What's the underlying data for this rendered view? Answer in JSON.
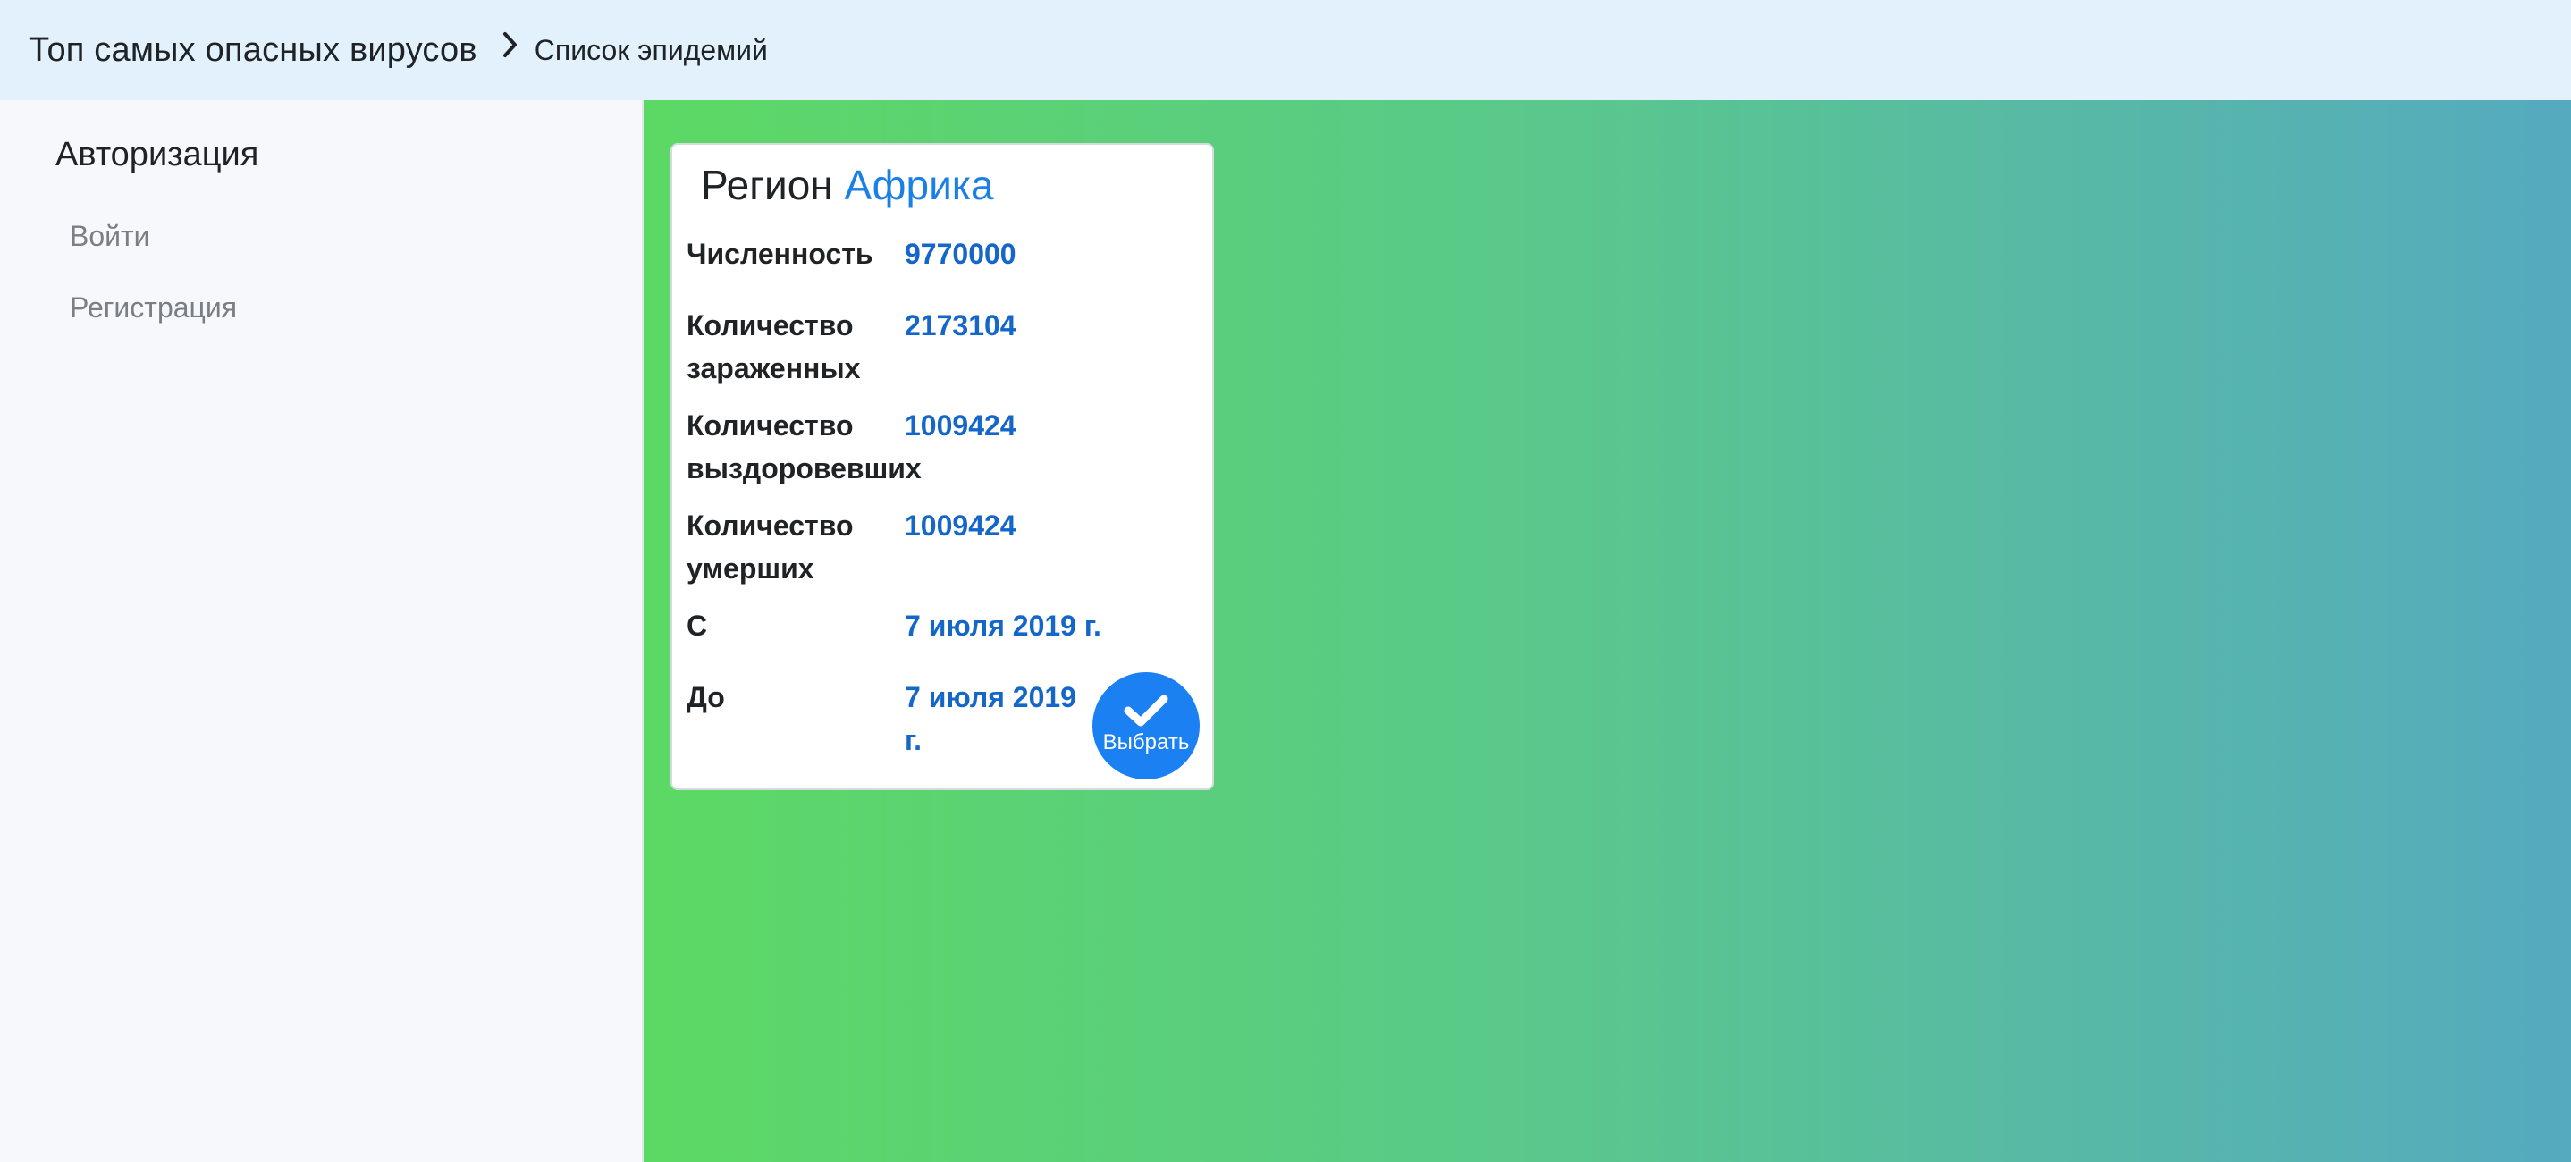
{
  "header": {
    "breadcrumb_root": "Топ самых опасных вирусов",
    "breadcrumb_current": "Список эпидемий"
  },
  "sidebar": {
    "title": "Авторизация",
    "items": [
      {
        "label": "Войти"
      },
      {
        "label": "Регистрация"
      }
    ]
  },
  "card": {
    "title_prefix": "Регион",
    "region_name": "Африка",
    "rows": [
      {
        "label": "Численность",
        "value": "9770000"
      },
      {
        "label": "Количество зараженных",
        "value": "2173104"
      },
      {
        "label": "Количество выздоровевших",
        "value": "1009424"
      },
      {
        "label": "Количество умерших",
        "value": "1009424"
      },
      {
        "label": "С",
        "value": "7 июля 2019 г."
      },
      {
        "label": "До",
        "value": "7 июля 2019 г."
      }
    ],
    "select_label": "Выбрать"
  },
  "colors": {
    "header_bg": "#e2f1fc",
    "accent": "#1b80f2",
    "value_text": "#1466c8",
    "gradient_start": "#5cd964",
    "gradient_end": "#55aabf"
  },
  "icons": {
    "breadcrumb_separator": "chevron-right-icon",
    "select": "check-icon"
  }
}
